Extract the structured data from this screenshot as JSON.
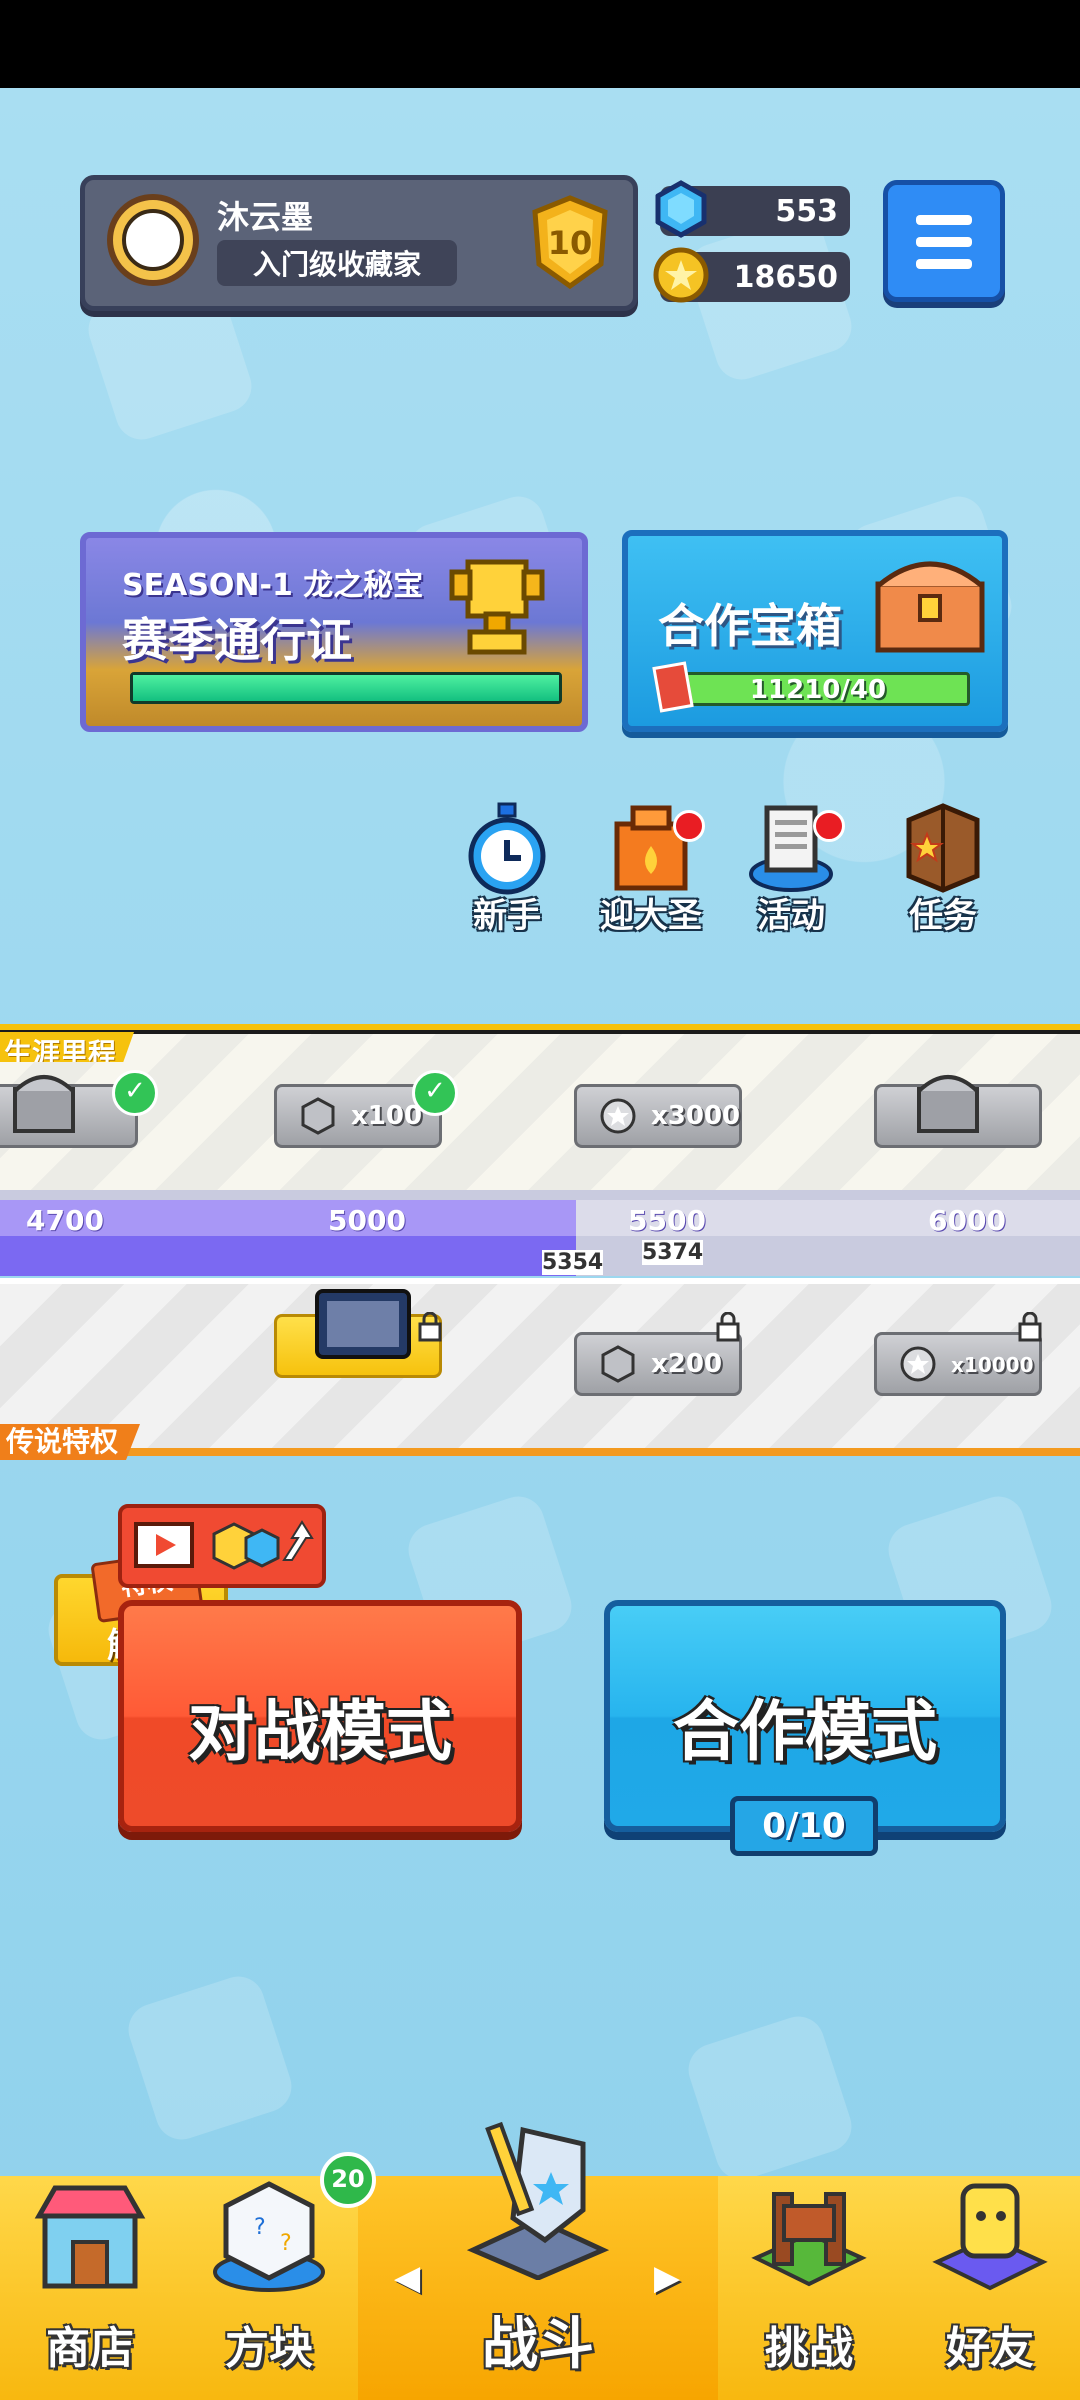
{
  "player": {
    "name": "沐云墨",
    "title": "入门级收藏家",
    "rank_level": "10"
  },
  "currency": {
    "gems": "553",
    "coins": "18650"
  },
  "season_card": {
    "season_label": "SEASON-1 龙之秘宝",
    "title": "赛季通行证",
    "progress": 1.0
  },
  "coop_chest": {
    "title": "合作宝箱",
    "progress_text": "11210/40"
  },
  "quick_icons": [
    {
      "label": "新手",
      "icon": "stopwatch-icon",
      "dot": false
    },
    {
      "label": "迎大圣",
      "icon": "event-tower-icon",
      "dot": true
    },
    {
      "label": "活动",
      "icon": "document-icon",
      "dot": true
    },
    {
      "label": "任务",
      "icon": "task-book-icon",
      "dot": false
    }
  ],
  "career": {
    "label": "生涯里程",
    "rewards_top": [
      {
        "text": "",
        "icon": "chest-icon",
        "claimed": true
      },
      {
        "text": "x100",
        "icon": "diamond-gem-icon",
        "claimed": true
      },
      {
        "text": "x3000",
        "icon": "coin-icon",
        "claimed": false
      },
      {
        "text": "",
        "icon": "chest-icon",
        "claimed": false
      }
    ],
    "ticks": [
      "4700",
      "5000",
      "5500",
      "6000"
    ],
    "current_value": "5354",
    "next_value": "5374",
    "premium_label": "传说特权",
    "unlock_tag": "特权",
    "unlock_label": "解锁",
    "rewards_bottom": [
      {
        "text": "",
        "icon": "board-icon",
        "locked": true
      },
      {
        "text": "x200",
        "icon": "diamond-gem-icon",
        "locked": true
      },
      {
        "text": "x10000",
        "icon": "coin-icon",
        "locked": true
      }
    ]
  },
  "modes": {
    "pvp": "对战模式",
    "coop": "合作模式",
    "coop_count": "0/10"
  },
  "nav": {
    "items": [
      {
        "label": "商店",
        "icon": "shop-icon"
      },
      {
        "label": "方块",
        "icon": "dice-block-icon",
        "badge": "20"
      },
      {
        "label": "战斗",
        "icon": "battle-shield-icon"
      },
      {
        "label": "挑战",
        "icon": "challenge-board-icon"
      },
      {
        "label": "好友",
        "icon": "friends-icon"
      }
    ]
  },
  "colors": {
    "accent_yellow": "#f8b80f",
    "pvp_red": "#ff5a36",
    "coop_blue": "#27b4ee",
    "track_purple": "#7b69f2"
  }
}
